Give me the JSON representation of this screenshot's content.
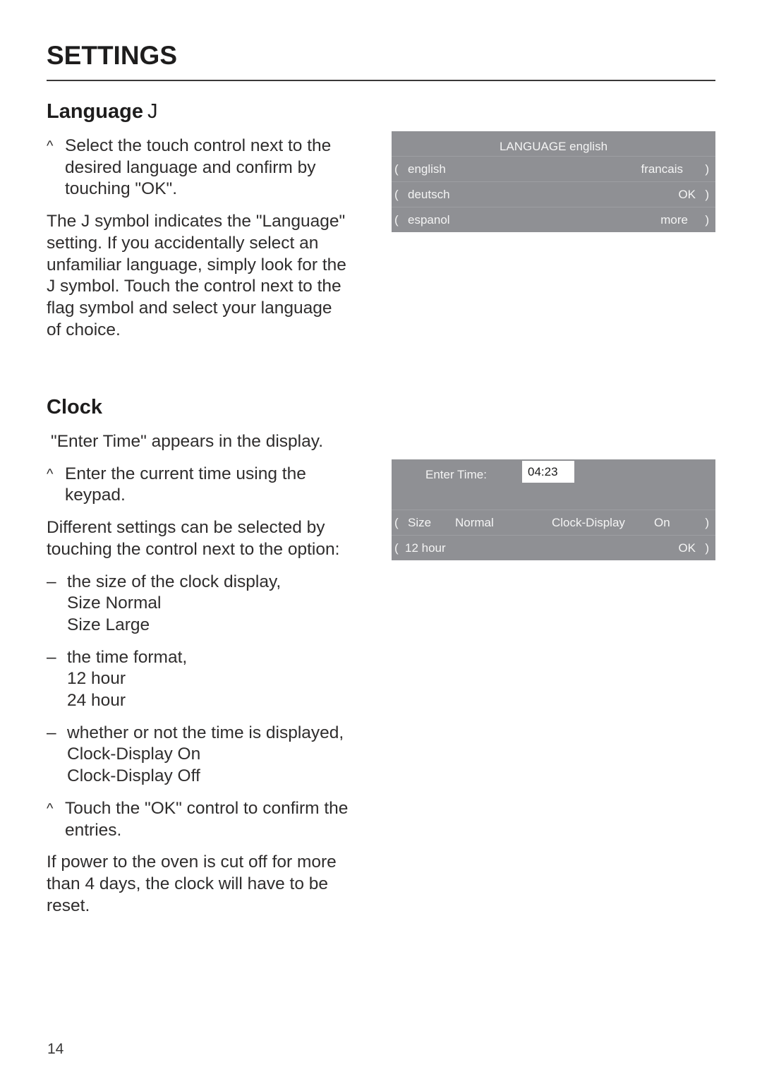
{
  "page": {
    "title": "SETTINGS",
    "page_number": "14"
  },
  "language_section": {
    "heading": "Language",
    "symbol": "J",
    "steps": [
      {
        "bullet": "^",
        "lines": [
          "Select the touch control next to the",
          "desired language and confirm by",
          "touching \"OK\"."
        ]
      }
    ],
    "paragraph_lines": [
      "The J  symbol indicates the \"Language\"",
      "setting. If you accidentally select an",
      "unfamiliar language, simply look for the",
      "J  symbol. Touch the control next to the",
      "flag symbol and select your language",
      "of choice."
    ],
    "display": {
      "header": "LANGUAGE english",
      "paren_left": "(",
      "paren_right": ")",
      "rows": [
        {
          "left": "english",
          "right": "francais"
        },
        {
          "left": "deutsch",
          "right": "OK"
        },
        {
          "left": "espanol",
          "right": "more"
        }
      ],
      "background": "#8f9094"
    }
  },
  "clock_section": {
    "heading": "Clock",
    "intro": "\"Enter Time\" appears in the display.",
    "step1": {
      "bullet": "^",
      "lines": [
        "Enter the current time using the",
        "keypad."
      ]
    },
    "options_intro_lines": [
      "Different settings can be selected by",
      "touching the control next to the option:"
    ],
    "options": [
      {
        "dash": "–",
        "label": "the size of the clock display,",
        "values": [
          "Size Normal",
          "Size Large"
        ]
      },
      {
        "dash": "–",
        "label": "the time format,",
        "values": [
          "12 hour",
          "24 hour"
        ]
      },
      {
        "dash": "–",
        "label": "whether or not the time is displayed,",
        "values": [
          "Clock-Display On",
          "Clock-Display Off"
        ]
      }
    ],
    "step2": {
      "bullet": "^",
      "lines": [
        "Touch the \"OK\" control to confirm the",
        "entries."
      ]
    },
    "note_lines": [
      "If power to the oven is cut off for more",
      "than 4 days, the clock will have to be",
      "reset."
    ],
    "display": {
      "enter_time_label": "Enter Time:",
      "time_value": "04:23",
      "paren_left": "(",
      "paren_right": ")",
      "row1": {
        "size_label": "Size",
        "size_value": "Normal",
        "clock_display_label": "Clock-Display",
        "clock_display_value": "On"
      },
      "row2": {
        "format": "12 hour",
        "ok": "OK"
      },
      "background": "#8f9094"
    }
  }
}
